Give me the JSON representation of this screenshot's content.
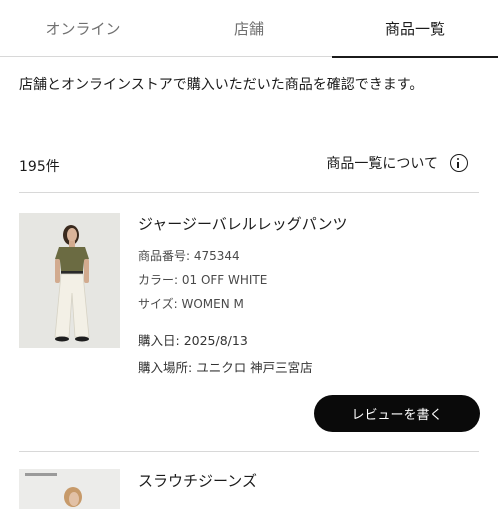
{
  "tabs": [
    {
      "label": "オンライン"
    },
    {
      "label": "店舗"
    },
    {
      "label": "商品一覧"
    }
  ],
  "description": "店舗とオンラインストアで購入いただいた商品を確認できます。",
  "count": "195件",
  "about_label": "商品一覧について",
  "items": [
    {
      "name": "ジャージーバレルレッグパンツ",
      "product_no": {
        "key": "商品番号: ",
        "value": "475344"
      },
      "color": {
        "key": "カラー: ",
        "value": "01 OFF WHITE"
      },
      "size": {
        "key": "サイズ: ",
        "value": "WOMEN M"
      },
      "purchase_date": {
        "key": "購入日: ",
        "value": "2025/8/13"
      },
      "purchase_place": {
        "key": "購入場所: ",
        "value": "ユニクロ 神戸三宮店"
      },
      "review_button": "レビューを書く"
    },
    {
      "name": "スラウチジーンズ"
    }
  ],
  "colors": {
    "accent": "#0a0a0a",
    "divider": "#d8d8d8",
    "muted_tab": "#707070"
  }
}
